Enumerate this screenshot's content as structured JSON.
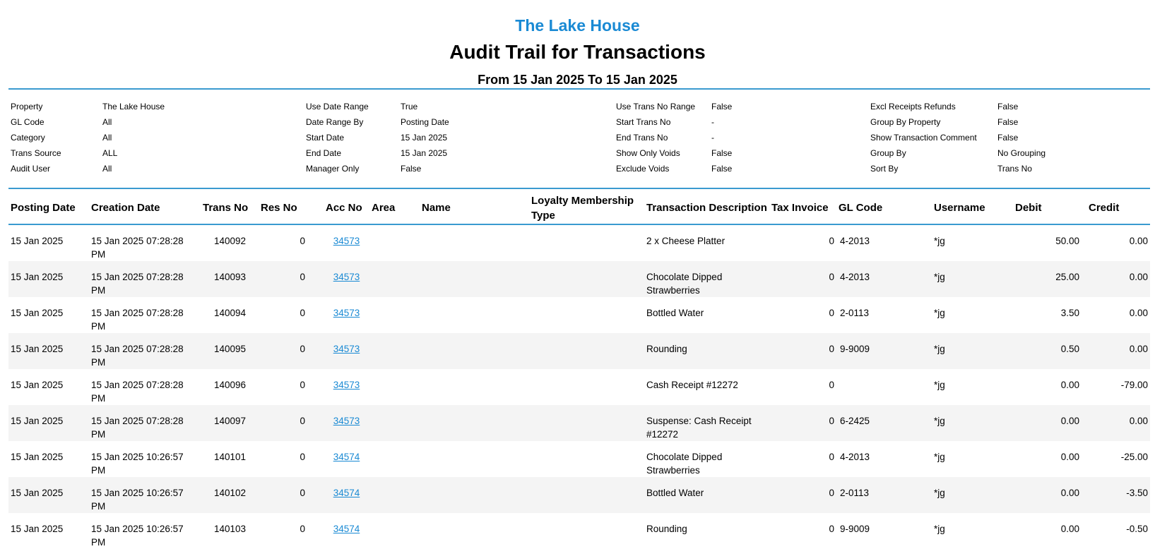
{
  "header": {
    "property_name": "The Lake House",
    "title": "Audit Trail for Transactions",
    "date_range": "From 15 Jan 2025 To 15 Jan 2025"
  },
  "params": [
    [
      {
        "label": "Property",
        "value": "The Lake House"
      },
      {
        "label": "GL Code",
        "value": "All"
      },
      {
        "label": "Category",
        "value": "All"
      },
      {
        "label": "Trans Source",
        "value": "ALL"
      },
      {
        "label": "Audit User",
        "value": "All"
      }
    ],
    [
      {
        "label": "Use Date Range",
        "value": "True"
      },
      {
        "label": "Date Range By",
        "value": "Posting Date"
      },
      {
        "label": "Start Date",
        "value": "15 Jan 2025"
      },
      {
        "label": "End Date",
        "value": "15 Jan 2025"
      },
      {
        "label": "Manager Only",
        "value": "False"
      }
    ],
    [
      {
        "label": "Use Trans No Range",
        "value": "False"
      },
      {
        "label": "Start Trans No",
        "value": "-"
      },
      {
        "label": "End Trans No",
        "value": "-"
      },
      {
        "label": "Show Only Voids",
        "value": "False"
      },
      {
        "label": "Exclude Voids",
        "value": "False"
      }
    ],
    [
      {
        "label": "Excl Receipts Refunds",
        "value": "False"
      },
      {
        "label": "Group By Property",
        "value": "False"
      },
      {
        "label": "Show Transaction Comment",
        "value": "False"
      },
      {
        "label": "Group By",
        "value": "No Grouping"
      },
      {
        "label": "Sort By",
        "value": "Trans No"
      }
    ]
  ],
  "table": {
    "columns": {
      "posting_date": "Posting Date",
      "creation_date": "Creation Date",
      "trans_no": "Trans No",
      "res_no": "Res No",
      "acc_no": "Acc No",
      "area": "Area",
      "name": "Name",
      "loyalty": "Loyalty Membership Type",
      "description": "Transaction Description",
      "tax_invoice": "Tax Invoice",
      "gl_code": "GL Code",
      "username": "Username",
      "debit": "Debit",
      "credit": "Credit"
    },
    "rows": [
      {
        "posting_date": "15 Jan 2025",
        "creation_date": "15 Jan 2025 07:28:28 PM",
        "trans_no": "140092",
        "res_no": "0",
        "acc_no": "34573",
        "area": "",
        "name": "",
        "loyalty": "",
        "description": "2 x Cheese Platter",
        "tax_invoice": "0",
        "gl_code": "4-2013",
        "username": "*jg",
        "debit": "50.00",
        "credit": "0.00"
      },
      {
        "posting_date": "15 Jan 2025",
        "creation_date": "15 Jan 2025 07:28:28 PM",
        "trans_no": "140093",
        "res_no": "0",
        "acc_no": "34573",
        "area": "",
        "name": "",
        "loyalty": "",
        "description": "Chocolate Dipped Strawberries",
        "tax_invoice": "0",
        "gl_code": "4-2013",
        "username": "*jg",
        "debit": "25.00",
        "credit": "0.00"
      },
      {
        "posting_date": "15 Jan 2025",
        "creation_date": "15 Jan 2025 07:28:28 PM",
        "trans_no": "140094",
        "res_no": "0",
        "acc_no": "34573",
        "area": "",
        "name": "",
        "loyalty": "",
        "description": "Bottled Water",
        "tax_invoice": "0",
        "gl_code": "2-0113",
        "username": "*jg",
        "debit": "3.50",
        "credit": "0.00"
      },
      {
        "posting_date": "15 Jan 2025",
        "creation_date": "15 Jan 2025 07:28:28 PM",
        "trans_no": "140095",
        "res_no": "0",
        "acc_no": "34573",
        "area": "",
        "name": "",
        "loyalty": "",
        "description": "Rounding",
        "tax_invoice": "0",
        "gl_code": "9-9009",
        "username": "*jg",
        "debit": "0.50",
        "credit": "0.00"
      },
      {
        "posting_date": "15 Jan 2025",
        "creation_date": "15 Jan 2025 07:28:28 PM",
        "trans_no": "140096",
        "res_no": "0",
        "acc_no": "34573",
        "area": "",
        "name": "",
        "loyalty": "",
        "description": "Cash Receipt #12272",
        "tax_invoice": "0",
        "gl_code": "",
        "username": "*jg",
        "debit": "0.00",
        "credit": "-79.00"
      },
      {
        "posting_date": "15 Jan 2025",
        "creation_date": "15 Jan 2025 07:28:28 PM",
        "trans_no": "140097",
        "res_no": "0",
        "acc_no": "34573",
        "area": "",
        "name": "",
        "loyalty": "",
        "description": "Suspense: Cash Receipt #12272",
        "tax_invoice": "0",
        "gl_code": "6-2425",
        "username": "*jg",
        "debit": "0.00",
        "credit": "0.00"
      },
      {
        "posting_date": "15 Jan 2025",
        "creation_date": "15 Jan 2025 10:26:57 PM",
        "trans_no": "140101",
        "res_no": "0",
        "acc_no": "34574",
        "area": "",
        "name": "",
        "loyalty": "",
        "description": "Chocolate Dipped Strawberries",
        "tax_invoice": "0",
        "gl_code": "4-2013",
        "username": "*jg",
        "debit": "0.00",
        "credit": "-25.00"
      },
      {
        "posting_date": "15 Jan 2025",
        "creation_date": "15 Jan 2025 10:26:57 PM",
        "trans_no": "140102",
        "res_no": "0",
        "acc_no": "34574",
        "area": "",
        "name": "",
        "loyalty": "",
        "description": "Bottled Water",
        "tax_invoice": "0",
        "gl_code": "2-0113",
        "username": "*jg",
        "debit": "0.00",
        "credit": "-3.50"
      },
      {
        "posting_date": "15 Jan 2025",
        "creation_date": "15 Jan 2025 10:26:57 PM",
        "trans_no": "140103",
        "res_no": "0",
        "acc_no": "34574",
        "area": "",
        "name": "",
        "loyalty": "",
        "description": "Rounding",
        "tax_invoice": "0",
        "gl_code": "9-9009",
        "username": "*jg",
        "debit": "0.00",
        "credit": "-0.50"
      }
    ]
  }
}
